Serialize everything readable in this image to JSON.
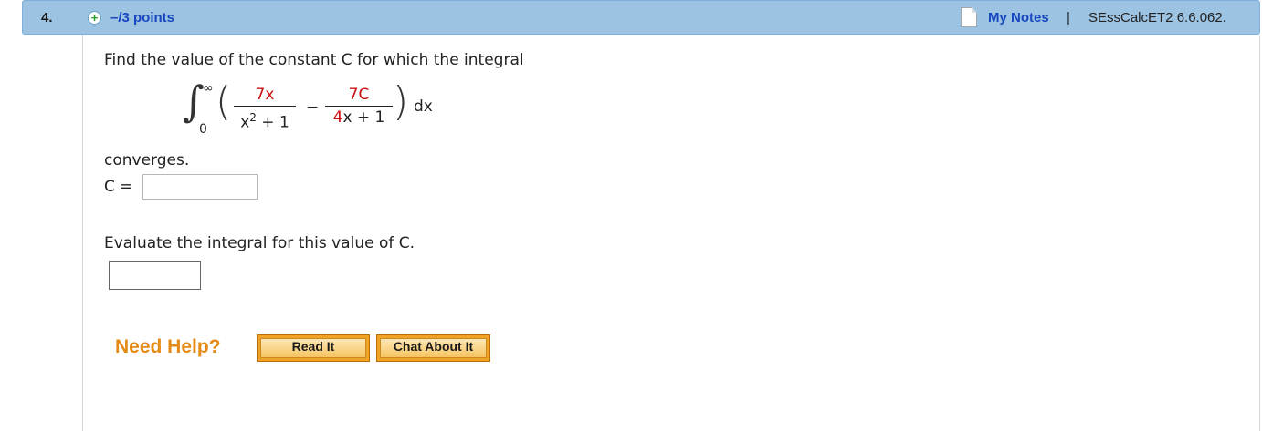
{
  "header": {
    "question_number": "4.",
    "points": "–/3 points",
    "my_notes": "My Notes",
    "separator": "|",
    "source": "SEssCalcET2 6.6.062."
  },
  "problem": {
    "intro": "Find the value of the constant C for which the integral",
    "integral": {
      "upper_limit": "∞",
      "lower_limit": "0",
      "term1_numerator": "7x",
      "term1_denominator_base": "x",
      "term1_denominator_exp": "2",
      "term1_denominator_rest": " + 1",
      "operator": "−",
      "term2_numerator": "7C",
      "term2_denominator": "4x + 1",
      "differential": "dx"
    },
    "converges": "converges.",
    "c_label": "C =",
    "c_value": "",
    "evaluate": "Evaluate the integral for this value of C.",
    "evaluate_value": ""
  },
  "help": {
    "label": "Need Help?",
    "read_it": "Read It",
    "chat_about_it": "Chat About It"
  },
  "colors": {
    "header_bg": "#9dc3e3",
    "link_blue": "#1646c0",
    "red_values": "#cc1111",
    "help_orange": "#e58a14"
  }
}
